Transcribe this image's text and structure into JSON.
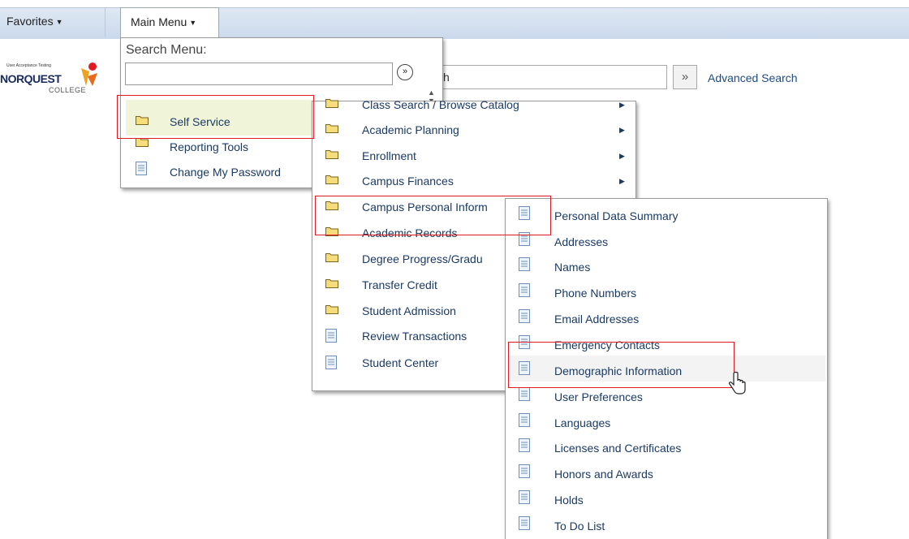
{
  "nav": {
    "favorites": "Favorites",
    "main_menu": "Main Menu"
  },
  "logo": {
    "tagline": "User Acceptance Testing",
    "name": "NORQUEST",
    "college": "COLLEGE"
  },
  "search": {
    "partial_text": "h",
    "advanced": "Advanced Search"
  },
  "main_menu": {
    "search_label": "Search Menu:",
    "items": [
      {
        "label": "Self Service",
        "icon": "folder-icon"
      },
      {
        "label": "Reporting Tools",
        "icon": "folder-icon"
      },
      {
        "label": "Change My Password",
        "icon": "page-icon"
      }
    ]
  },
  "self_service_menu": {
    "items": [
      {
        "label": "Class Search / Browse Catalog",
        "icon": "folder-icon"
      },
      {
        "label": "Academic Planning",
        "icon": "folder-icon"
      },
      {
        "label": "Enrollment",
        "icon": "folder-icon"
      },
      {
        "label": "Campus Finances",
        "icon": "folder-icon"
      },
      {
        "label": "Campus Personal Inform",
        "icon": "folder-icon"
      },
      {
        "label": "Academic Records",
        "icon": "folder-icon"
      },
      {
        "label": "Degree Progress/Gradu",
        "icon": "folder-icon"
      },
      {
        "label": "Transfer Credit",
        "icon": "folder-icon"
      },
      {
        "label": "Student Admission",
        "icon": "folder-icon"
      },
      {
        "label": "Review Transactions",
        "icon": "page-icon"
      },
      {
        "label": "Student Center",
        "icon": "page-icon"
      }
    ]
  },
  "personal_info_menu": {
    "items": [
      {
        "label": "Personal Data Summary"
      },
      {
        "label": "Addresses"
      },
      {
        "label": "Names"
      },
      {
        "label": "Phone Numbers"
      },
      {
        "label": "Email Addresses"
      },
      {
        "label": "Emergency Contacts"
      },
      {
        "label": "Demographic Information"
      },
      {
        "label": "User Preferences"
      },
      {
        "label": "Languages"
      },
      {
        "label": "Licenses and Certificates"
      },
      {
        "label": "Honors and Awards"
      },
      {
        "label": "Holds"
      },
      {
        "label": "To Do List"
      }
    ]
  },
  "colors": {
    "highlight_box": "#e11b22",
    "link": "#1c4c87",
    "selected_bg": "#f0f4d8"
  }
}
